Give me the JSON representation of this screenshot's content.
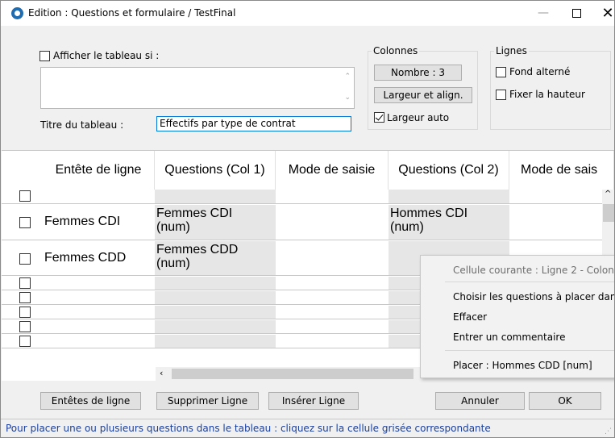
{
  "window": {
    "title": "Edition : Questions et formulaire / TestFinal",
    "minimize": "—",
    "close": "✕"
  },
  "top": {
    "afficher_label": "Afficher le tableau si :",
    "afficher_checked": false,
    "titre_label": "Titre du tableau :",
    "titre_value": "Effectifs par type de contrat"
  },
  "colonnes": {
    "title": "Colonnes",
    "nombre_button": "Nombre : 3",
    "largeur_align_button": "Largeur et align.",
    "largeur_auto_label": "Largeur auto",
    "largeur_auto_checked": true
  },
  "lignes": {
    "title": "Lignes",
    "fond_alterne_label": "Fond alterné",
    "fixer_hauteur_label": "Fixer la hauteur"
  },
  "table": {
    "headers": [
      "Entête de ligne",
      "Questions (Col 1)",
      "Mode de saisie",
      "Questions (Col 2)",
      "Mode de sais"
    ],
    "rows": [
      {
        "entete": "",
        "q1": "",
        "q2": ""
      },
      {
        "entete": "Femmes CDI",
        "q1": "Femmes CDI\n(num)",
        "q2": "Hommes CDI\n(num)"
      },
      {
        "entete": "Femmes CDD",
        "q1": "Femmes CDD\n(num)",
        "q2": ""
      },
      {
        "entete": "",
        "q1": "",
        "q2": ""
      },
      {
        "entete": "",
        "q1": "",
        "q2": ""
      },
      {
        "entete": "",
        "q1": "",
        "q2": ""
      },
      {
        "entete": "",
        "q1": "",
        "q2": ""
      },
      {
        "entete": "",
        "q1": "",
        "q2": ""
      }
    ]
  },
  "context_menu": {
    "header": "Cellule courante : Ligne 2 - Colon",
    "items": [
      "Choisir les questions à placer dan",
      "Effacer",
      "Entrer un commentaire"
    ],
    "place_item": "Placer : Hommes CDD [num]"
  },
  "buttons": {
    "entetes_ligne": "Entêtes de ligne",
    "supprimer_ligne": "Supprimer Ligne",
    "inserer_ligne": "Insérer Ligne",
    "annuler": "Annuler",
    "ok": "OK"
  },
  "status": "Pour placer une ou plusieurs questions dans le tableau : cliquez sur la cellule grisée correspondante"
}
